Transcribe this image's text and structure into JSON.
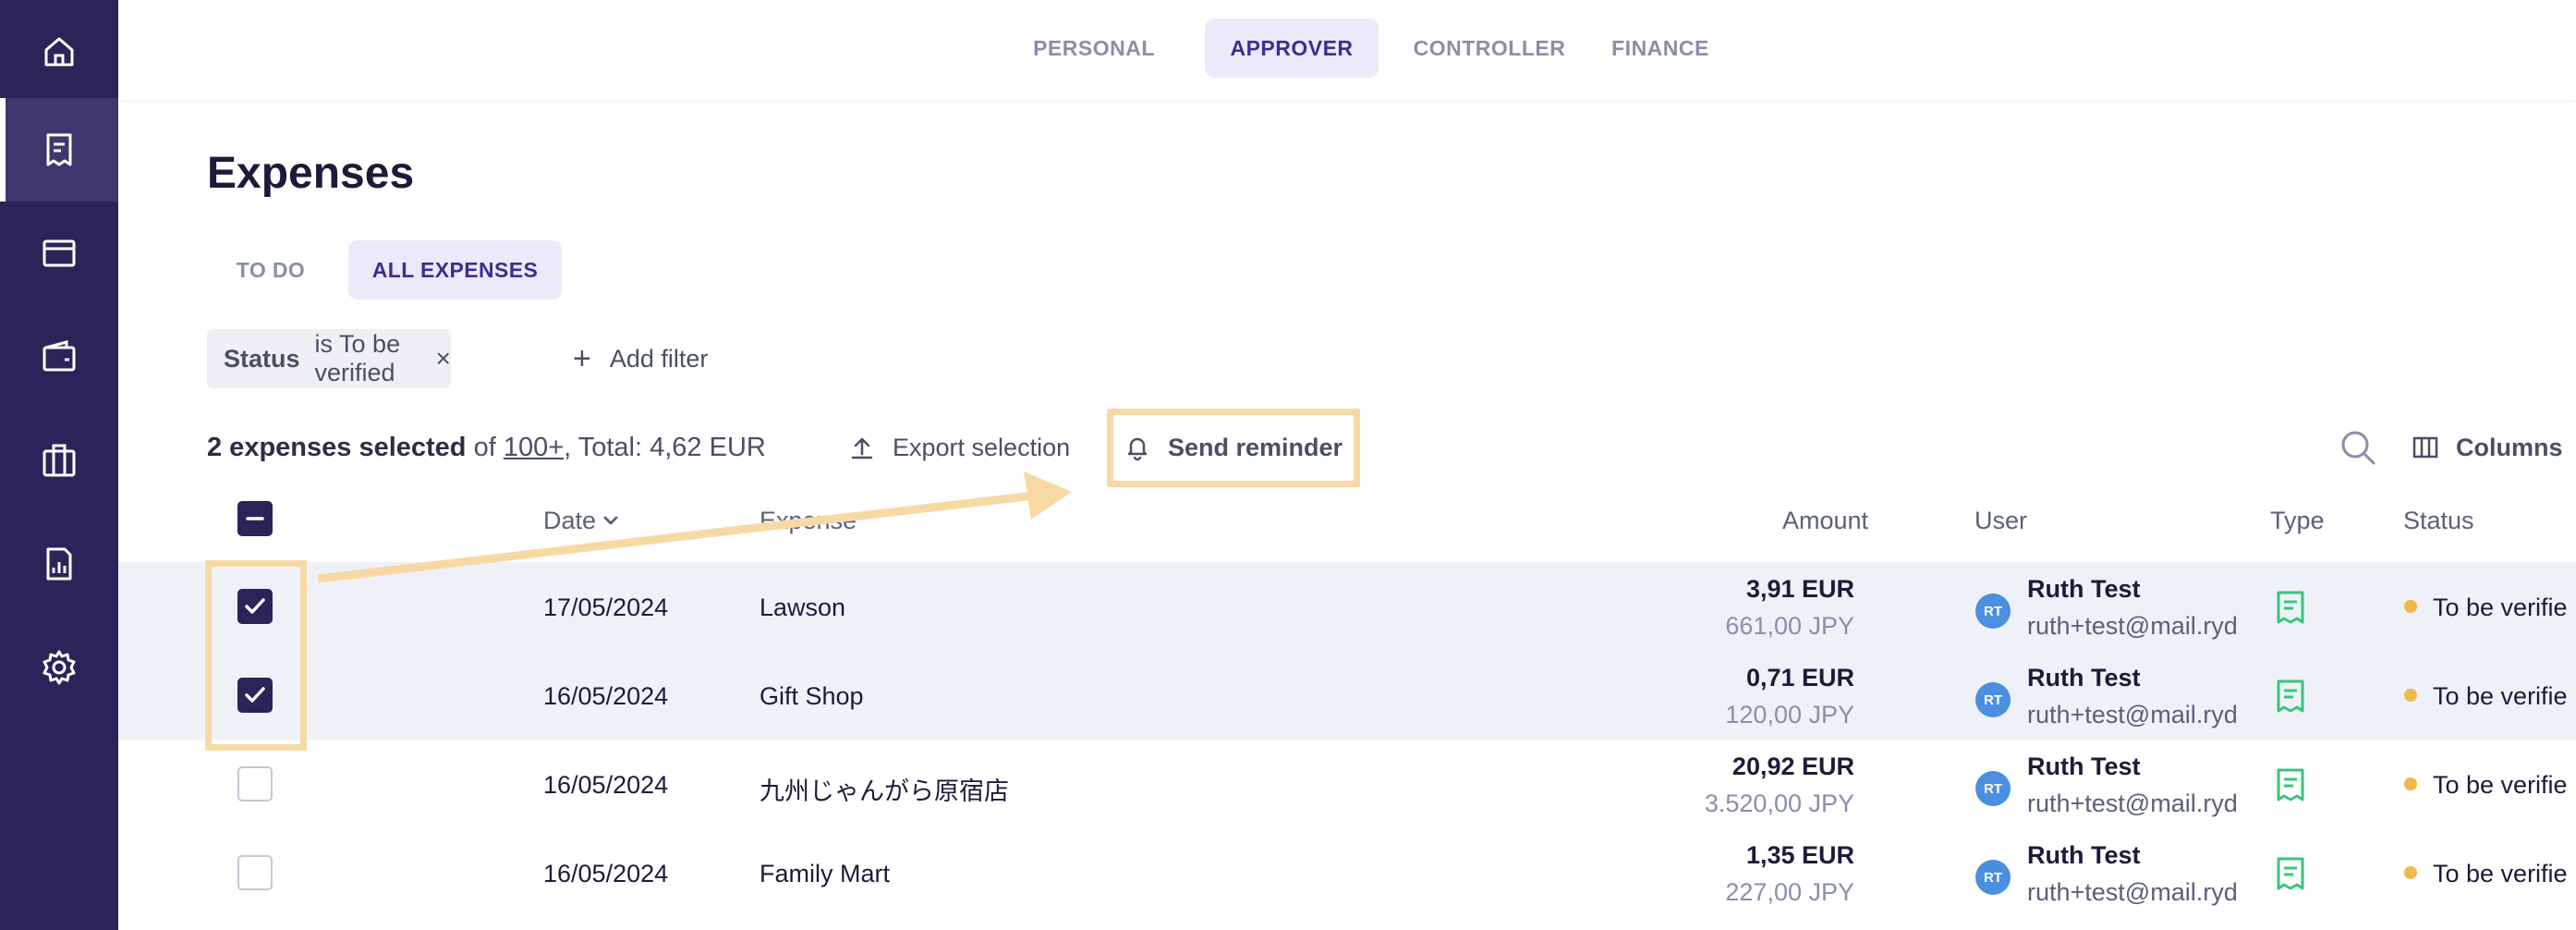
{
  "colors": {
    "sidebar": "#2a2459",
    "accent": "#3b2f8f",
    "highlight": "#f8d9a5",
    "status_dot": "#f0b94b",
    "receipt_icon": "#3cc47c",
    "avatar": "#4a8fe0"
  },
  "sidebar": {
    "items": [
      {
        "icon": "home-icon"
      },
      {
        "icon": "receipt-icon",
        "active": true
      },
      {
        "icon": "card-icon"
      },
      {
        "icon": "wallet-icon"
      },
      {
        "icon": "briefcase-icon"
      },
      {
        "icon": "report-icon"
      },
      {
        "icon": "settings-icon"
      }
    ]
  },
  "role_tabs": [
    {
      "label": "PERSONAL"
    },
    {
      "label": "APPROVER",
      "active": true
    },
    {
      "label": "CONTROLLER"
    },
    {
      "label": "FINANCE"
    }
  ],
  "page": {
    "title": "Expenses"
  },
  "view_tabs": [
    {
      "label": "TO DO"
    },
    {
      "label": "ALL EXPENSES",
      "active": true
    }
  ],
  "filter": {
    "key": "Status",
    "value": "is To be verified",
    "remove": "×",
    "add_label": "Add filter",
    "add_icon": "+"
  },
  "selection": {
    "selected_text": "2 expenses selected",
    "of": " of ",
    "count_link": "100+",
    "total": ", Total: 4,62 EUR"
  },
  "actions": {
    "export": "Export selection",
    "reminder": "Send reminder",
    "columns": "Columns"
  },
  "table": {
    "headers": {
      "date": "Date",
      "expense": "Expense",
      "amount": "Amount",
      "user": "User",
      "type": "Type",
      "status": "Status"
    },
    "rows": [
      {
        "selected": true,
        "date": "17/05/2024",
        "expense": "Lawson",
        "amount": "3,91 EUR",
        "amount_orig": "661,00 JPY",
        "initials": "RT",
        "user": "Ruth Test",
        "email": "ruth+test@mail.ryd",
        "status": "To be verifie"
      },
      {
        "selected": true,
        "date": "16/05/2024",
        "expense": "Gift Shop",
        "amount": "0,71 EUR",
        "amount_orig": "120,00 JPY",
        "initials": "RT",
        "user": "Ruth Test",
        "email": "ruth+test@mail.ryd",
        "status": "To be verifie"
      },
      {
        "selected": false,
        "date": "16/05/2024",
        "expense": "九州じゃんがら原宿店",
        "amount": "20,92 EUR",
        "amount_orig": "3.520,00 JPY",
        "initials": "RT",
        "user": "Ruth Test",
        "email": "ruth+test@mail.ryd",
        "status": "To be verifie"
      },
      {
        "selected": false,
        "date": "16/05/2024",
        "expense": "Family Mart",
        "amount": "1,35 EUR",
        "amount_orig": "227,00 JPY",
        "initials": "RT",
        "user": "Ruth Test",
        "email": "ruth+test@mail.ryd",
        "status": "To be verifie"
      }
    ]
  }
}
